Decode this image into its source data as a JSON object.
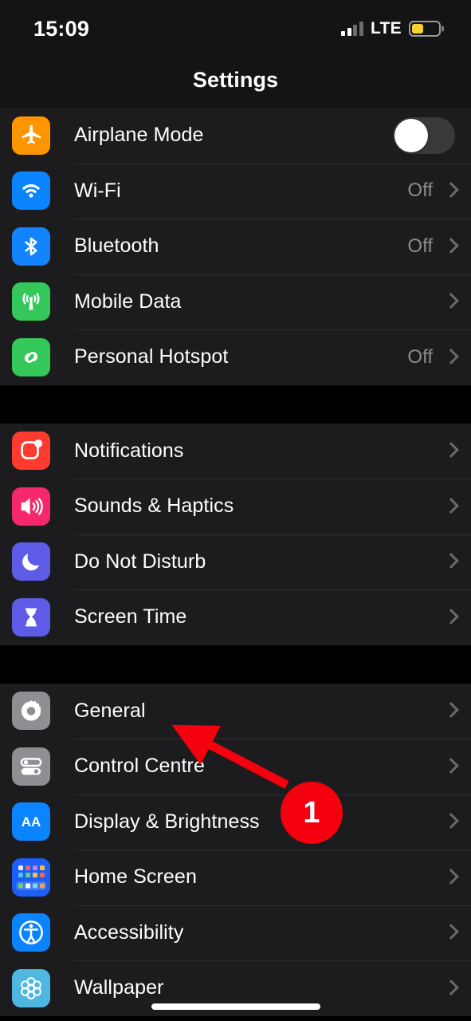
{
  "status_bar": {
    "time": "15:09",
    "network_label": "LTE",
    "signal_bars_filled": 2,
    "signal_bars_total": 4,
    "battery_percent": 45,
    "battery_color": "#f8d330",
    "low_power_mode": true
  },
  "nav": {
    "title": "Settings"
  },
  "groups": [
    {
      "rows": [
        {
          "label": "Airplane Mode",
          "icon": "airplane-icon",
          "icon_color": "#ff9500",
          "accessory": "toggle",
          "toggle_on": false
        },
        {
          "label": "Wi-Fi",
          "icon": "wifi-icon",
          "icon_color": "#0a84ff",
          "accessory": "chevron",
          "value": "Off"
        },
        {
          "label": "Bluetooth",
          "icon": "bluetooth-icon",
          "icon_color": "#1284ff",
          "accessory": "chevron",
          "value": "Off"
        },
        {
          "label": "Mobile Data",
          "icon": "mobile-data-icon",
          "icon_color": "#34c759",
          "accessory": "chevron",
          "value": ""
        },
        {
          "label": "Personal Hotspot",
          "icon": "hotspot-icon",
          "icon_color": "#34c759",
          "accessory": "chevron",
          "value": "Off"
        }
      ]
    },
    {
      "rows": [
        {
          "label": "Notifications",
          "icon": "notifications-icon",
          "icon_color": "#ff3b30",
          "accessory": "chevron",
          "value": ""
        },
        {
          "label": "Sounds & Haptics",
          "icon": "sounds-icon",
          "icon_color": "#f4286a",
          "accessory": "chevron",
          "value": ""
        },
        {
          "label": "Do Not Disturb",
          "icon": "moon-icon",
          "icon_color": "#5e5ce6",
          "accessory": "chevron",
          "value": ""
        },
        {
          "label": "Screen Time",
          "icon": "hourglass-icon",
          "icon_color": "#5e5ce6",
          "accessory": "chevron",
          "value": ""
        }
      ]
    },
    {
      "rows": [
        {
          "label": "General",
          "icon": "gear-icon",
          "icon_color": "#8e8e93",
          "accessory": "chevron",
          "value": ""
        },
        {
          "label": "Control Centre",
          "icon": "control-centre-icon",
          "icon_color": "#8e8e93",
          "accessory": "chevron",
          "value": ""
        },
        {
          "label": "Display & Brightness",
          "icon": "display-brightness-icon",
          "icon_color": "#0a84ff",
          "accessory": "chevron",
          "value": ""
        },
        {
          "label": "Home Screen",
          "icon": "home-screen-icon",
          "icon_color": "#1d5ff5",
          "accessory": "chevron",
          "value": ""
        },
        {
          "label": "Accessibility",
          "icon": "accessibility-icon",
          "icon_color": "#0a84ff",
          "accessory": "chevron",
          "value": ""
        },
        {
          "label": "Wallpaper",
          "icon": "wallpaper-icon",
          "icon_color": "#4fb8e0",
          "accessory": "chevron",
          "value": ""
        }
      ]
    }
  ],
  "annotation": {
    "badge_number": "1",
    "badge_color": "#f5000f",
    "arrow_target": "General"
  }
}
